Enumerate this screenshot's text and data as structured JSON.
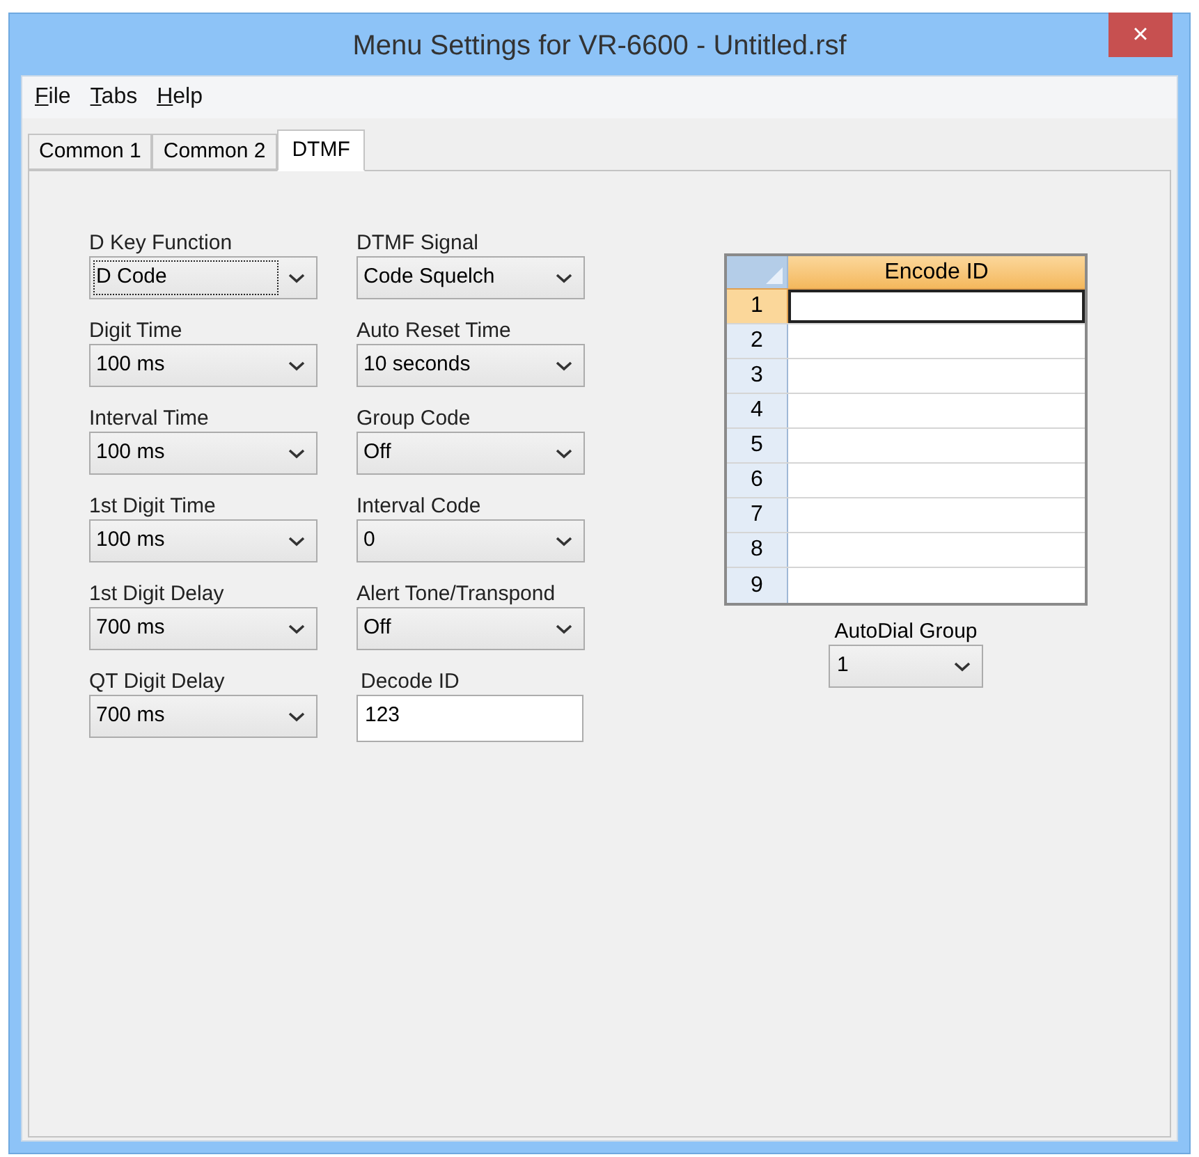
{
  "window": {
    "title": "Menu Settings for VR-6600 - Untitled.rsf",
    "close": "×"
  },
  "menu": [
    "File",
    "Tabs",
    "Help"
  ],
  "tabs": [
    {
      "label": "Common 1",
      "selected": false
    },
    {
      "label": "Common 2",
      "selected": false
    },
    {
      "label": "DTMF",
      "selected": true
    }
  ],
  "left_fields": [
    {
      "label": "D Key Function",
      "kind": "combo",
      "value": "D Code",
      "focused": true
    },
    {
      "label": "Digit Time",
      "kind": "combo",
      "value": "100 ms",
      "focused": false
    },
    {
      "label": "Interval Time",
      "kind": "combo",
      "value": "100 ms",
      "focused": false
    },
    {
      "label": "1st Digit Time",
      "kind": "combo",
      "value": "100 ms",
      "focused": false
    },
    {
      "label": "1st Digit Delay",
      "kind": "combo",
      "value": "700 ms",
      "focused": false
    },
    {
      "label": "QT Digit Delay",
      "kind": "combo",
      "value": "700 ms",
      "focused": false
    }
  ],
  "right_fields": [
    {
      "label": "DTMF Signal",
      "kind": "combo",
      "value": "Code Squelch",
      "focused": false
    },
    {
      "label": "Auto Reset Time",
      "kind": "combo",
      "value": "10 seconds",
      "focused": false
    },
    {
      "label": "Group Code",
      "kind": "combo",
      "value": "Off",
      "focused": false
    },
    {
      "label": "Interval Code",
      "kind": "combo",
      "value": "0",
      "focused": false
    },
    {
      "label": "Alert Tone/Transpond",
      "kind": "combo",
      "value": "Off",
      "focused": false
    },
    {
      "label": "Decode ID",
      "kind": "text",
      "value": "123",
      "focused": false
    }
  ],
  "encode_table": {
    "columns": [
      "Encode ID"
    ],
    "rows": [
      {
        "number": "1",
        "selected": true
      },
      {
        "number": "2",
        "selected": false
      },
      {
        "number": "3",
        "selected": false
      },
      {
        "number": "4",
        "selected": false
      },
      {
        "number": "5",
        "selected": false
      },
      {
        "number": "6",
        "selected": false
      },
      {
        "number": "7",
        "selected": false
      },
      {
        "number": "8",
        "selected": false
      },
      {
        "number": "9",
        "selected": false
      }
    ]
  },
  "autodial": {
    "label": "AutoDial Group",
    "value": "1"
  }
}
